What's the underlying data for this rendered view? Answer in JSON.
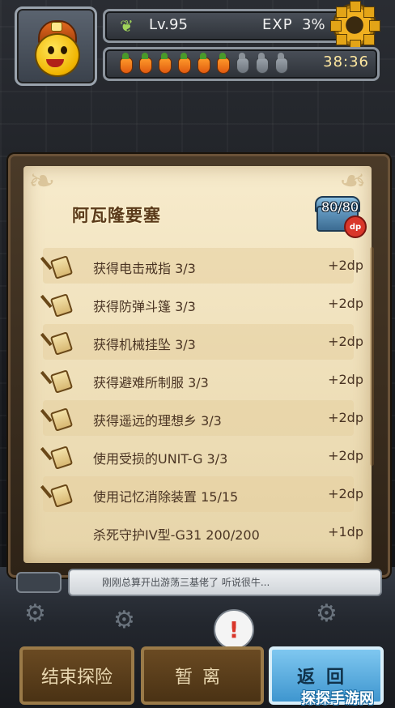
{
  "hud": {
    "level_label": "Lv.95",
    "exp_label": "EXP",
    "exp_value": "3%",
    "timer": "38:36",
    "food": {
      "filled": 6,
      "total": 9
    }
  },
  "panel": {
    "title": "阿瓦隆要塞",
    "chest_text": "80/80",
    "chest_badge": "dp",
    "quests": [
      {
        "text": "获得电击戒指 3/3",
        "reward": "+2dp"
      },
      {
        "text": "获得防弹斗篷 3/3",
        "reward": "+2dp"
      },
      {
        "text": "获得机械挂坠 3/3",
        "reward": "+2dp"
      },
      {
        "text": "获得避难所制服 3/3",
        "reward": "+2dp"
      },
      {
        "text": "获得遥远的理想乡 3/3",
        "reward": "+2dp"
      },
      {
        "text": "使用受损的UNIT-G 3/3",
        "reward": "+2dp"
      },
      {
        "text": "使用记忆消除装置 15/15",
        "reward": "+2dp"
      },
      {
        "text": "杀死守护IV型-G31 200/200",
        "reward": "+1dp"
      }
    ]
  },
  "chat": {
    "message": "刚刚总算开出游荡三基佬了 听说很牛..."
  },
  "alert_symbol": "!",
  "buttons": {
    "end_label": "结束探险",
    "leave_label": "暂离",
    "back_label": "返回"
  },
  "watermark": "探探手游网"
}
